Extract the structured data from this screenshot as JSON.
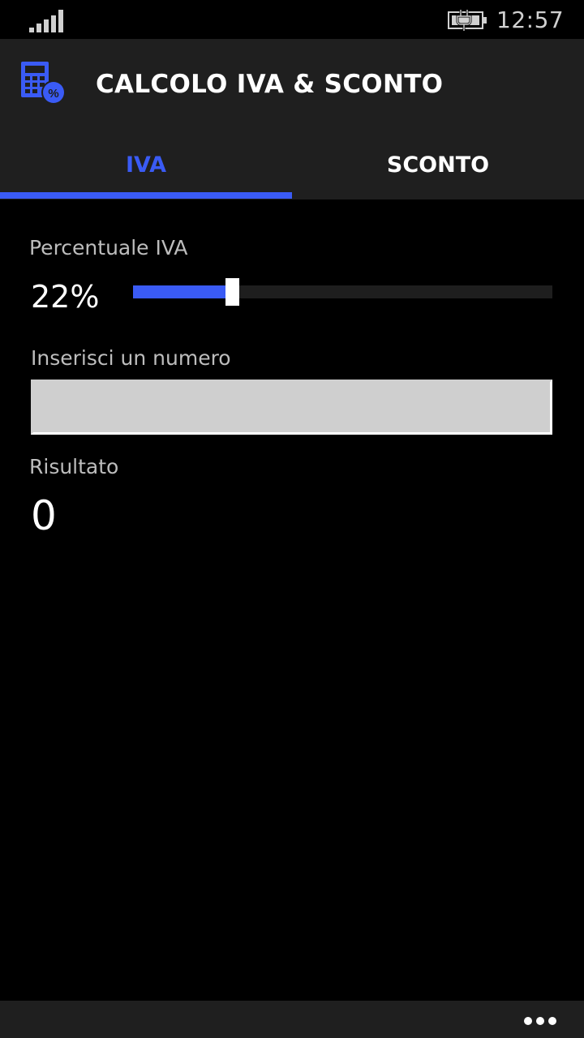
{
  "status_bar": {
    "time": "12:57",
    "signal_icon": "signal-strength-icon",
    "battery_icon": "battery-charging-icon"
  },
  "header": {
    "app_icon": "calculator-percent-icon",
    "title": "CALCOLO IVA & SCONTO"
  },
  "tabs": [
    {
      "label": "IVA",
      "selected": true
    },
    {
      "label": "SCONTO",
      "selected": false
    }
  ],
  "iva": {
    "percent_label": "Percentuale IVA",
    "percent_value": "22%",
    "slider_value": 22,
    "slider_min": 0,
    "slider_max": 100,
    "input_label": "Inserisci un numero",
    "input_value": "",
    "result_label": "Risultato",
    "result_value": "0"
  },
  "app_bar": {
    "more_icon": "ellipsis-icon"
  },
  "colors": {
    "accent": "#3a5bf5",
    "header_bg": "#1f1f1f",
    "background": "#000000",
    "label_gray": "#bdbdbd"
  }
}
